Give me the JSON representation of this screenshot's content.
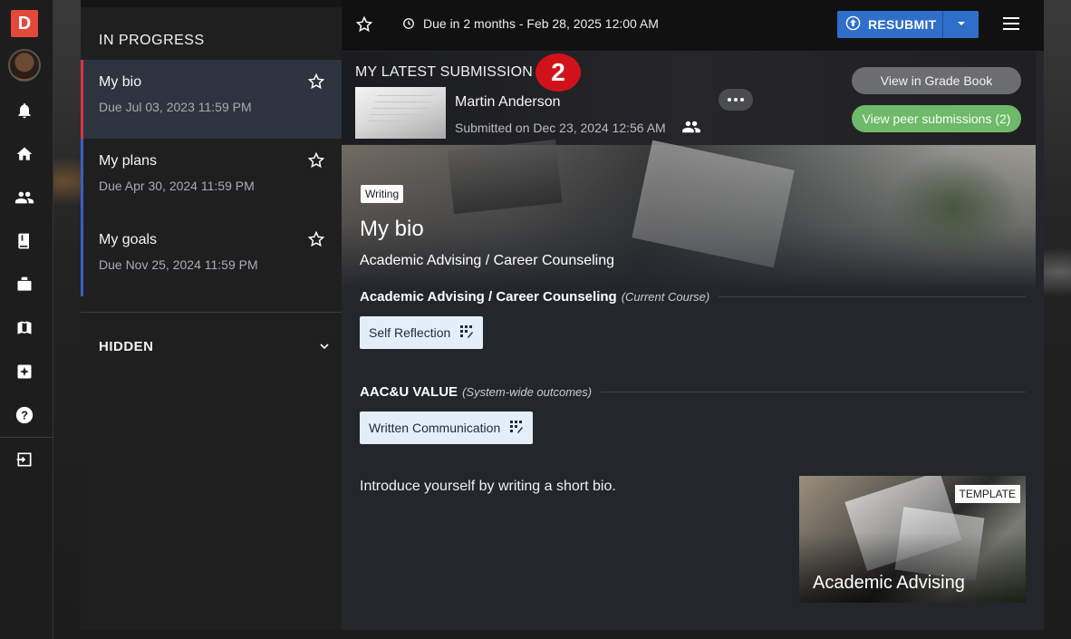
{
  "app": {
    "logo_letter": "D"
  },
  "rail": {
    "items": [
      {
        "name": "notifications",
        "icon": "bell-icon"
      },
      {
        "name": "home",
        "icon": "home-icon"
      },
      {
        "name": "people",
        "icon": "people-icon"
      },
      {
        "name": "library",
        "icon": "book-icon"
      },
      {
        "name": "portfolio",
        "icon": "briefcase-icon"
      },
      {
        "name": "catalog",
        "icon": "books-icon"
      },
      {
        "name": "highlights",
        "icon": "sparkle-icon"
      },
      {
        "name": "help",
        "icon": "help-icon"
      },
      {
        "name": "sign-out",
        "icon": "exit-icon"
      }
    ]
  },
  "list": {
    "in_progress_title": "IN PROGRESS",
    "items": [
      {
        "title": "My bio",
        "due": "Due Jul 03, 2023 11:59 PM"
      },
      {
        "title": "My plans",
        "due": "Due Apr 30, 2024 11:59 PM"
      },
      {
        "title": "My goals",
        "due": "Due Nov 25, 2024 11:59 PM"
      }
    ],
    "hidden_title": "HIDDEN"
  },
  "topnav": {
    "due_text": "Due in 2 months - Feb 28, 2025 12:00 AM",
    "resubmit_label": "RESUBMIT"
  },
  "submission": {
    "label": "MY LATEST SUBMISSION",
    "badge": "2",
    "student_name": "Martin Anderson",
    "submitted": "Submitted on Dec 23, 2024 12:56 AM",
    "grade_book_label": "View in Grade Book",
    "peer_label": "View peer submissions (2)"
  },
  "assignment": {
    "tag": "Writing",
    "title": "My bio",
    "course": "Academic Advising / Career Counseling",
    "outcomes": [
      {
        "heading": "Academic Advising / Career Counseling",
        "note": "(Current Course)",
        "chip": "Self Reflection"
      },
      {
        "heading": "AAC&U VALUE",
        "note": "(System-wide outcomes)",
        "chip": "Written Communication"
      }
    ],
    "intro": "Introduce yourself by writing a short bio.",
    "template_tag": "TEMPLATE",
    "template_name": "Academic Advising"
  },
  "colors": {
    "accent_blue": "#2f6fc9",
    "active_border": "#d9363e",
    "peer_green": "#6fb96a",
    "badge_red": "#d1121a",
    "logo_red": "#e2493b"
  }
}
